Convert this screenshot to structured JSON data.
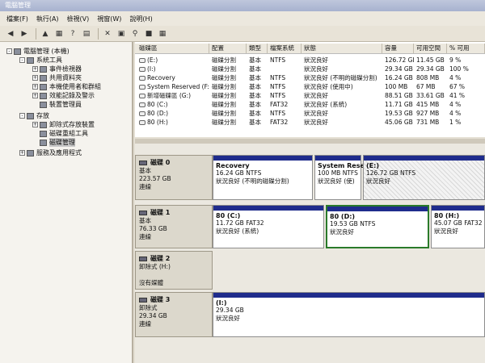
{
  "window": {
    "title": "電腦管理"
  },
  "menu": [
    "檔案(F)",
    "執行(A)",
    "檢視(V)",
    "視窗(W)",
    "說明(H)"
  ],
  "toolbar": {
    "icons": [
      "back-icon",
      "forward-icon",
      "up-folder-icon",
      "show-hide-tree-icon",
      "help-icon",
      "properties-icon",
      "delete-icon",
      "open-icon",
      "search-icon",
      "action-icon",
      "refresh-icon"
    ]
  },
  "tree": {
    "items": [
      {
        "label": "電腦管理 (本機)",
        "level": 0,
        "exp": "-"
      },
      {
        "label": "系統工具",
        "level": 1,
        "exp": "-"
      },
      {
        "label": "事件檢視器",
        "level": 2,
        "exp": "+"
      },
      {
        "label": "共用資料夾",
        "level": 2,
        "exp": "+"
      },
      {
        "label": "本機使用者和群組",
        "level": 2,
        "exp": "+"
      },
      {
        "label": "效能記錄及警示",
        "level": 2,
        "exp": "+"
      },
      {
        "label": "裝置管理員",
        "level": 2,
        "exp": ""
      },
      {
        "label": "存放",
        "level": 1,
        "exp": "-"
      },
      {
        "label": "卸除式存放裝置",
        "level": 2,
        "exp": "+"
      },
      {
        "label": "磁碟重組工具",
        "level": 2,
        "exp": ""
      },
      {
        "label": "磁碟管理",
        "level": 2,
        "exp": "",
        "selected": true
      },
      {
        "label": "服務及應用程式",
        "level": 1,
        "exp": "+"
      }
    ]
  },
  "volume_list": {
    "columns": [
      "磁碟區",
      "配置",
      "類型",
      "檔案系統",
      "狀態",
      "容量",
      "可用空間",
      "% 可用"
    ],
    "rows": [
      [
        "(E:)",
        "磁碟分割",
        "基本",
        "NTFS",
        "狀況良好",
        "126.72 GB",
        "11.45 GB",
        "9 %"
      ],
      [
        "(I:)",
        "磁碟分割",
        "基本",
        "",
        "狀況良好",
        "29.34 GB",
        "29.34 GB",
        "100 %"
      ],
      [
        "Recovery",
        "磁碟分割",
        "基本",
        "NTFS",
        "狀況良好 (不明的磁碟分割)",
        "16.24 GB",
        "808 MB",
        "4 %"
      ],
      [
        "System Reserved (F:)",
        "磁碟分割",
        "基本",
        "NTFS",
        "狀況良好 (使用中)",
        "100 MB",
        "67 MB",
        "67 %"
      ],
      [
        "新增磁碟區 (G:)",
        "磁碟分割",
        "基本",
        "NTFS",
        "狀況良好",
        "88.51 GB",
        "33.61 GB",
        "41 %"
      ],
      [
        "80 (C:)",
        "磁碟分割",
        "基本",
        "FAT32",
        "狀況良好 (系統)",
        "11.71 GB",
        "415 MB",
        "4 %"
      ],
      [
        "80 (D:)",
        "磁碟分割",
        "基本",
        "NTFS",
        "狀況良好",
        "19.53 GB",
        "927 MB",
        "4 %"
      ],
      [
        "80 (H:)",
        "磁碟分割",
        "基本",
        "FAT32",
        "狀況良好",
        "45.06 GB",
        "731 MB",
        "1 %"
      ]
    ]
  },
  "disks": [
    {
      "name": "磁碟 0",
      "lines": [
        "基本",
        "223.57 GB",
        "連線"
      ],
      "partitions": [
        {
          "name": "Recovery",
          "lines": [
            "16.24 GB NTFS",
            "狀況良好 (不明的磁碟分割)"
          ]
        },
        {
          "name": "System Rese",
          "lines": [
            "100 MB NTFS",
            "狀況良好 (使)"
          ]
        },
        {
          "name": "(E:)",
          "lines": [
            "126.72 GB NTFS",
            "狀況良好"
          ]
        }
      ]
    },
    {
      "name": "磁碟 1",
      "lines": [
        "基本",
        "76.33 GB",
        "連線"
      ],
      "partitions": [
        {
          "name": "80 (C:)",
          "lines": [
            "11.72 GB FAT32",
            "狀況良好 (系統)"
          ]
        },
        {
          "name": "80 (D:)",
          "lines": [
            "19.53 GB NTFS",
            "狀況良好"
          ]
        },
        {
          "name": "80 (H:)",
          "lines": [
            "45.07 GB FAT32",
            "狀況良好"
          ]
        }
      ]
    },
    {
      "name": "磁碟 2",
      "lines": [
        "卸除式 (H:)",
        "",
        "沒有媒體"
      ],
      "partitions": []
    },
    {
      "name": "磁碟 3",
      "lines": [
        "卸除式",
        "29.34 GB",
        "連線"
      ],
      "partitions": [
        {
          "name": "(I:)",
          "lines": [
            "29.34 GB",
            "狀況良好"
          ]
        }
      ]
    }
  ]
}
